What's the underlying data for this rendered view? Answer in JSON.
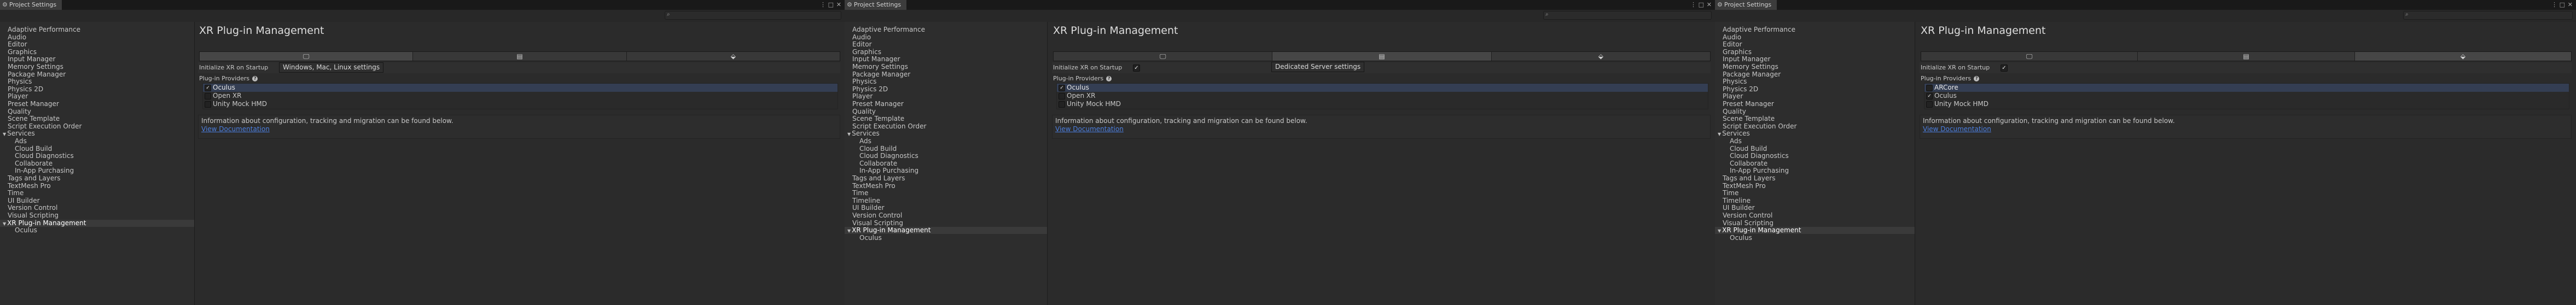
{
  "panels": [
    {
      "window_title": "Project Settings",
      "search": {
        "placeholder": ""
      },
      "sidebar": [
        {
          "label": "Adaptive Performance",
          "level": 0
        },
        {
          "label": "Audio",
          "level": 0
        },
        {
          "label": "Editor",
          "level": 0
        },
        {
          "label": "Graphics",
          "level": 0
        },
        {
          "label": "Input Manager",
          "level": 0
        },
        {
          "label": "Memory Settings",
          "level": 0
        },
        {
          "label": "Package Manager",
          "level": 0
        },
        {
          "label": "Physics",
          "level": 0
        },
        {
          "label": "Physics 2D",
          "level": 0
        },
        {
          "label": "Player",
          "level": 0
        },
        {
          "label": "Preset Manager",
          "level": 0
        },
        {
          "label": "Quality",
          "level": 0
        },
        {
          "label": "Scene Template",
          "level": 0
        },
        {
          "label": "Script Execution Order",
          "level": 0
        },
        {
          "label": "Services",
          "level": 0,
          "expanded": true
        },
        {
          "label": "Ads",
          "level": 1
        },
        {
          "label": "Cloud Build",
          "level": 1
        },
        {
          "label": "Cloud Diagnostics",
          "level": 1
        },
        {
          "label": "Collaborate",
          "level": 1
        },
        {
          "label": "In-App Purchasing",
          "level": 1
        },
        {
          "label": "Tags and Layers",
          "level": 0
        },
        {
          "label": "TextMesh Pro",
          "level": 0
        },
        {
          "label": "Time",
          "level": 0
        },
        {
          "label": "UI Builder",
          "level": 0
        },
        {
          "label": "Version Control",
          "level": 0
        },
        {
          "label": "Visual Scripting",
          "level": 0
        },
        {
          "label": "XR Plug-in Management",
          "level": 0,
          "expanded": true,
          "selected": true
        },
        {
          "label": "Oculus",
          "level": 1
        }
      ],
      "page_title": "XR Plug-in Management",
      "platform_tabs": [
        {
          "icon": "monitor-icon",
          "glyph": "🖵",
          "active": true
        },
        {
          "icon": "server-icon",
          "glyph": "▤",
          "active": false
        },
        {
          "icon": "android-icon",
          "glyph": "⬙",
          "active": false
        }
      ],
      "tooltip": "Windows, Mac, Linux settings",
      "init_label": "Initialize XR on Startup",
      "init_checked": true,
      "providers_label": "Plug-in Providers",
      "providers": [
        {
          "label": "Oculus",
          "checked": true,
          "highlight": true
        },
        {
          "label": "Open XR",
          "checked": false,
          "highlight": false
        },
        {
          "label": "Unity Mock HMD",
          "checked": false,
          "highlight": false
        }
      ],
      "info_text": "Information about configuration, tracking and migration can be found below.",
      "doc_link": "View Documentation"
    },
    {
      "window_title": "Project Settings",
      "search": {
        "placeholder": ""
      },
      "sidebar": [
        {
          "label": "Adaptive Performance",
          "level": 0
        },
        {
          "label": "Audio",
          "level": 0
        },
        {
          "label": "Editor",
          "level": 0
        },
        {
          "label": "Graphics",
          "level": 0
        },
        {
          "label": "Input Manager",
          "level": 0
        },
        {
          "label": "Memory Settings",
          "level": 0
        },
        {
          "label": "Package Manager",
          "level": 0
        },
        {
          "label": "Physics",
          "level": 0
        },
        {
          "label": "Physics 2D",
          "level": 0
        },
        {
          "label": "Player",
          "level": 0
        },
        {
          "label": "Preset Manager",
          "level": 0
        },
        {
          "label": "Quality",
          "level": 0
        },
        {
          "label": "Scene Template",
          "level": 0
        },
        {
          "label": "Script Execution Order",
          "level": 0
        },
        {
          "label": "Services",
          "level": 0,
          "expanded": true
        },
        {
          "label": "Ads",
          "level": 1
        },
        {
          "label": "Cloud Build",
          "level": 1
        },
        {
          "label": "Cloud Diagnostics",
          "level": 1
        },
        {
          "label": "Collaborate",
          "level": 1
        },
        {
          "label": "In-App Purchasing",
          "level": 1
        },
        {
          "label": "Tags and Layers",
          "level": 0
        },
        {
          "label": "TextMesh Pro",
          "level": 0
        },
        {
          "label": "Time",
          "level": 0
        },
        {
          "label": "Timeline",
          "level": 0
        },
        {
          "label": "UI Builder",
          "level": 0
        },
        {
          "label": "Version Control",
          "level": 0
        },
        {
          "label": "Visual Scripting",
          "level": 0
        },
        {
          "label": "XR Plug-in Management",
          "level": 0,
          "expanded": true,
          "selected": true
        },
        {
          "label": "Oculus",
          "level": 1
        }
      ],
      "page_title": "XR Plug-in Management",
      "platform_tabs": [
        {
          "icon": "monitor-icon",
          "glyph": "🖵",
          "active": false
        },
        {
          "icon": "server-icon",
          "glyph": "▤",
          "active": true
        },
        {
          "icon": "android-icon",
          "glyph": "⬙",
          "active": false
        }
      ],
      "tooltip": "Dedicated Server settings",
      "init_label": "Initialize XR on Startup",
      "init_checked": true,
      "providers_label": "Plug-in Providers",
      "providers": [
        {
          "label": "Oculus",
          "checked": true,
          "highlight": true
        },
        {
          "label": "Open XR",
          "checked": false,
          "highlight": false
        },
        {
          "label": "Unity Mock HMD",
          "checked": false,
          "highlight": false
        }
      ],
      "info_text": "Information about configuration, tracking and migration can be found below.",
      "doc_link": "View Documentation"
    },
    {
      "window_title": "Project Settings",
      "search": {
        "placeholder": ""
      },
      "sidebar": [
        {
          "label": "Adaptive Performance",
          "level": 0
        },
        {
          "label": "Audio",
          "level": 0
        },
        {
          "label": "Editor",
          "level": 0
        },
        {
          "label": "Graphics",
          "level": 0
        },
        {
          "label": "Input Manager",
          "level": 0
        },
        {
          "label": "Memory Settings",
          "level": 0
        },
        {
          "label": "Package Manager",
          "level": 0
        },
        {
          "label": "Physics",
          "level": 0
        },
        {
          "label": "Physics 2D",
          "level": 0
        },
        {
          "label": "Player",
          "level": 0
        },
        {
          "label": "Preset Manager",
          "level": 0
        },
        {
          "label": "Quality",
          "level": 0
        },
        {
          "label": "Scene Template",
          "level": 0
        },
        {
          "label": "Script Execution Order",
          "level": 0
        },
        {
          "label": "Services",
          "level": 0,
          "expanded": true
        },
        {
          "label": "Ads",
          "level": 1
        },
        {
          "label": "Cloud Build",
          "level": 1
        },
        {
          "label": "Cloud Diagnostics",
          "level": 1
        },
        {
          "label": "Collaborate",
          "level": 1
        },
        {
          "label": "In-App Purchasing",
          "level": 1
        },
        {
          "label": "Tags and Layers",
          "level": 0
        },
        {
          "label": "TextMesh Pro",
          "level": 0
        },
        {
          "label": "Time",
          "level": 0
        },
        {
          "label": "Timeline",
          "level": 0
        },
        {
          "label": "UI Builder",
          "level": 0
        },
        {
          "label": "Version Control",
          "level": 0
        },
        {
          "label": "Visual Scripting",
          "level": 0
        },
        {
          "label": "XR Plug-in Management",
          "level": 0,
          "expanded": true,
          "selected": true
        },
        {
          "label": "Oculus",
          "level": 1
        }
      ],
      "page_title": "XR Plug-in Management",
      "platform_tabs": [
        {
          "icon": "monitor-icon",
          "glyph": "🖵",
          "active": false
        },
        {
          "icon": "server-icon",
          "glyph": "▤",
          "active": false
        },
        {
          "icon": "android-icon",
          "glyph": "⬙",
          "active": true
        }
      ],
      "tooltip": "",
      "init_label": "Initialize XR on Startup",
      "init_checked": true,
      "providers_label": "Plug-in Providers",
      "providers": [
        {
          "label": "ARCore",
          "checked": false,
          "highlight": true
        },
        {
          "label": "Oculus",
          "checked": true,
          "highlight": false
        },
        {
          "label": "Unity Mock HMD",
          "checked": false,
          "highlight": false
        }
      ],
      "info_text": "Information about configuration, tracking and migration can be found below.",
      "doc_link": "View Documentation"
    }
  ]
}
